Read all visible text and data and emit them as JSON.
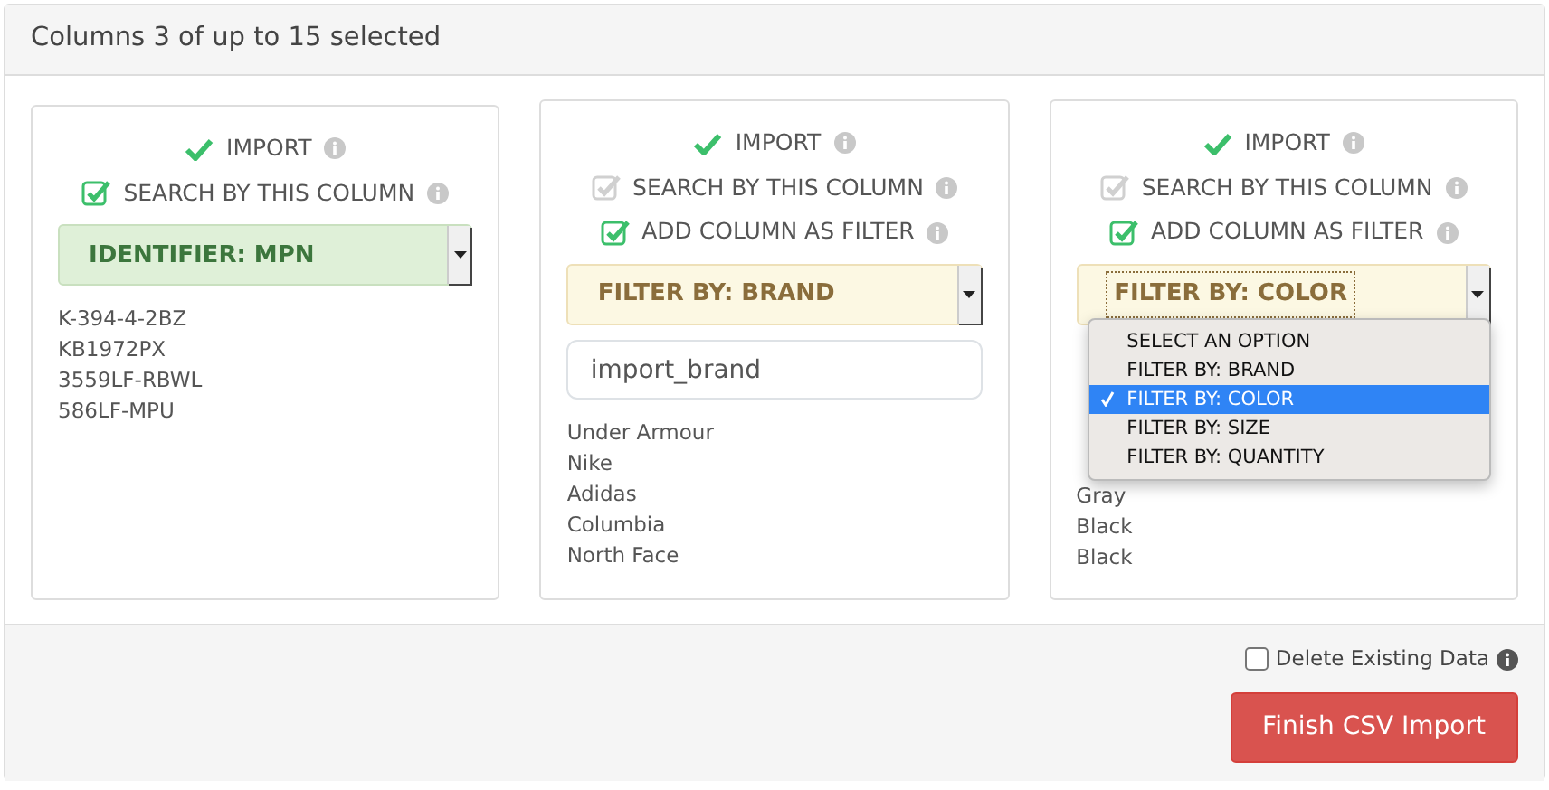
{
  "header": {
    "title": "Columns 3 of up to 15 selected"
  },
  "columns": [
    {
      "import": {
        "label": "IMPORT",
        "on": true
      },
      "options": [
        {
          "label": "SEARCH BY THIS COLUMN",
          "checked": true,
          "disabled": false
        }
      ],
      "select": {
        "kind": "identifier",
        "value": "IDENTIFIER: MPN"
      },
      "values": [
        "K-394-4-2BZ",
        "KB1972PX",
        "3559LF-RBWL",
        "586LF-MPU"
      ]
    },
    {
      "import": {
        "label": "IMPORT",
        "on": true
      },
      "options": [
        {
          "label": "SEARCH BY THIS COLUMN",
          "checked": true,
          "disabled": true
        },
        {
          "label": "ADD COLUMN AS FILTER",
          "checked": true,
          "disabled": false
        }
      ],
      "select": {
        "kind": "filter",
        "value": "FILTER BY: BRAND"
      },
      "field": {
        "value": "import_brand"
      },
      "values": [
        "Under Armour",
        "Nike",
        "Adidas",
        "Columbia",
        "North Face"
      ]
    },
    {
      "import": {
        "label": "IMPORT",
        "on": true
      },
      "options": [
        {
          "label": "SEARCH BY THIS COLUMN",
          "checked": true,
          "disabled": true
        },
        {
          "label": "ADD COLUMN AS FILTER",
          "checked": true,
          "disabled": false
        }
      ],
      "select": {
        "kind": "filter",
        "value": "FILTER BY: COLOR",
        "focused": true,
        "menu": [
          {
            "label": "SELECT AN OPTION",
            "selected": false
          },
          {
            "label": "FILTER BY: BRAND",
            "selected": false
          },
          {
            "label": "FILTER BY: COLOR",
            "selected": true
          },
          {
            "label": "FILTER BY: SIZE",
            "selected": false
          },
          {
            "label": "FILTER BY: QUANTITY",
            "selected": false
          }
        ]
      },
      "values": [
        "Gray",
        "Black",
        "Black"
      ]
    }
  ],
  "footer": {
    "delete": {
      "label": "Delete Existing Data",
      "checked": false
    },
    "button": "Finish CSV Import"
  }
}
